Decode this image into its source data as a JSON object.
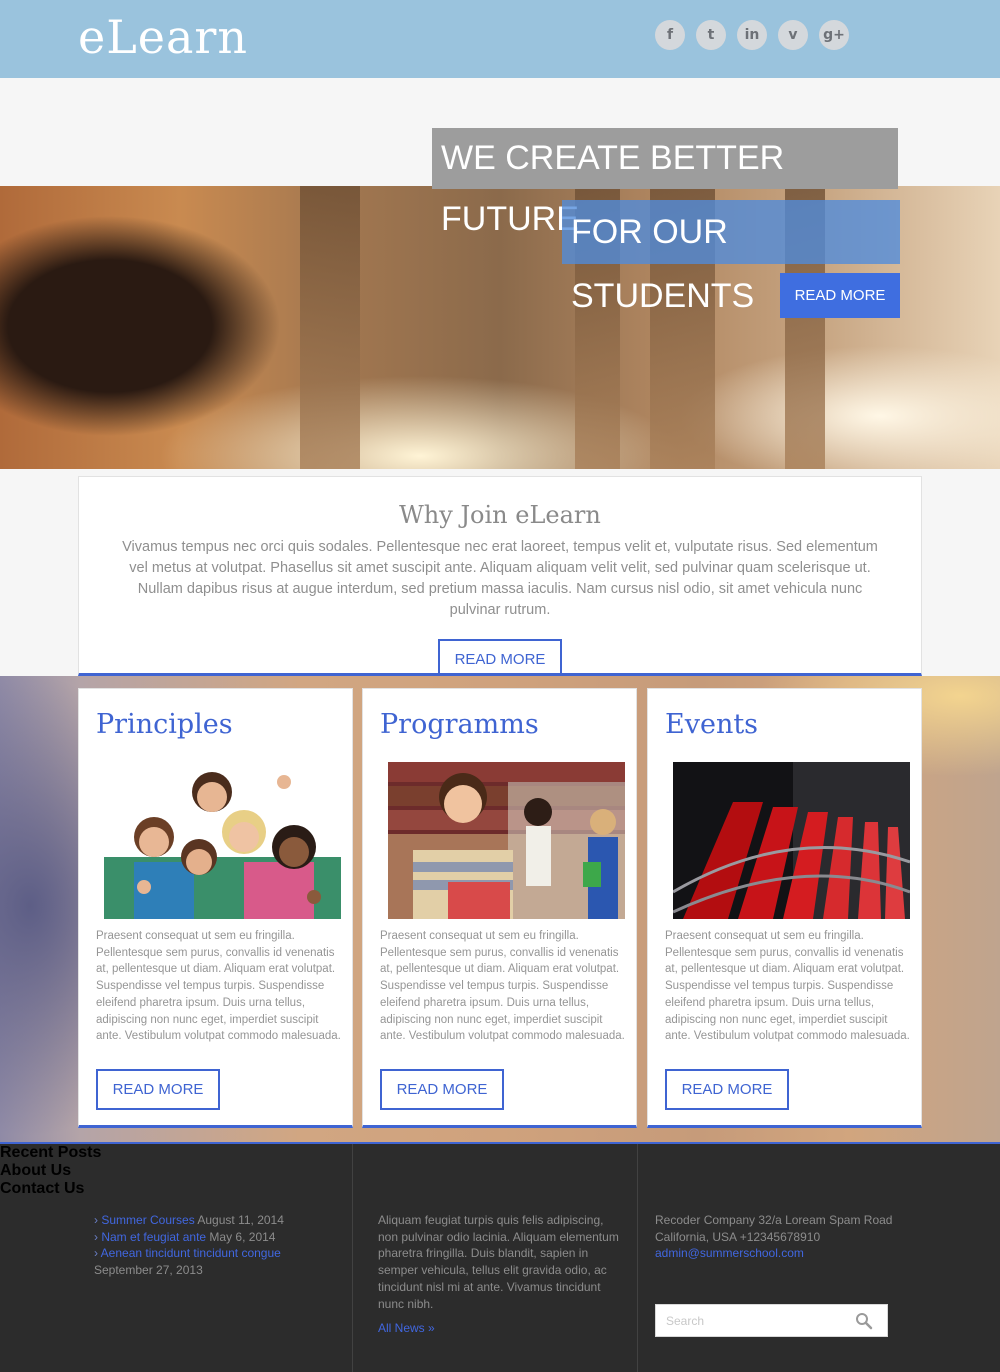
{
  "header": {
    "logo": "eLearn",
    "social": [
      {
        "icon": "facebook-icon",
        "glyph": "f"
      },
      {
        "icon": "tumblr-icon",
        "glyph": "t"
      },
      {
        "icon": "linkedin-icon",
        "glyph": "in"
      },
      {
        "icon": "vimeo-icon",
        "glyph": "v"
      },
      {
        "icon": "googleplus-icon",
        "glyph": "g+"
      }
    ]
  },
  "hero": {
    "line1": "WE CREATE BETTER FUTURE",
    "line2": "FOR OUR STUDENTS",
    "button": "READ MORE"
  },
  "why": {
    "title": "Why Join eLearn",
    "text": "Vivamus tempus nec orci quis sodales. Pellentesque nec erat laoreet, tempus velit et, vulputate risus. Sed elementum vel metus at volutpat. Phasellus sit amet suscipit ante. Aliquam aliquam velit velit, sed pulvinar quam scelerisque ut. Nullam dapibus risus at augue interdum, sed pretium massa iaculis. Nam cursus nisl odio, sit amet vehicula nunc pulvinar rutrum.",
    "button": "READ MORE"
  },
  "cards": [
    {
      "title": "Principles",
      "text": "Praesent consequat ut sem eu fringilla. Pellentesque sem purus, convallis id venenatis at, pellentesque ut diam. Aliquam erat volutpat. Suspendisse vel tempus turpis. Suspendisse eleifend pharetra ipsum. Duis urna tellus, adipiscing non nunc eget, imperdiet suscipit ante. Vestibulum volutpat commodo malesuada.",
      "button": "READ MORE"
    },
    {
      "title": "Programms",
      "text": "Praesent consequat ut sem eu fringilla. Pellentesque sem purus, convallis id venenatis at, pellentesque ut diam. Aliquam erat volutpat. Suspendisse vel tempus turpis. Suspendisse eleifend pharetra ipsum. Duis urna tellus, adipiscing non nunc eget, imperdiet suscipit ante. Vestibulum volutpat commodo malesuada.",
      "button": "READ MORE"
    },
    {
      "title": "Events",
      "text": "Praesent consequat ut sem eu fringilla. Pellentesque sem purus, convallis id venenatis at, pellentesque ut diam. Aliquam erat volutpat. Suspendisse vel tempus turpis. Suspendisse eleifend pharetra ipsum. Duis urna tellus, adipiscing non nunc eget, imperdiet suscipit ante. Vestibulum volutpat commodo malesuada.",
      "button": "READ MORE"
    }
  ],
  "footer": {
    "recent": {
      "title": "Recent Posts",
      "posts": [
        {
          "link": "Summer Courses",
          "date": "August 11, 2014"
        },
        {
          "link": "Nam et feugiat ante",
          "date": "May 6, 2014"
        },
        {
          "link": "Aenean tincidunt tincidunt congue",
          "date": "September 27, 2013"
        }
      ]
    },
    "about": {
      "title": "About Us",
      "text": "Aliquam feugiat turpis quis felis adipiscing, non pulvinar odio lacinia. Aliquam elementum pharetra fringilla. Duis blandit, sapien in semper vehicula, tellus elit gravida odio, ac tincidunt nisl mi at ante. Vivamus tincidunt nunc nibh.",
      "link": "All News »"
    },
    "contact": {
      "title": "Contact Us",
      "address1": "Recoder Company 32/a Loream Spam Road",
      "address2": "California, USA +12345678910",
      "email": "admin@summerschool.com",
      "search_placeholder": "Search"
    }
  },
  "colors": {
    "accent": "#3f64d2",
    "header_bg": "#9ac3dd",
    "footer_bg": "#2c2c2c"
  }
}
